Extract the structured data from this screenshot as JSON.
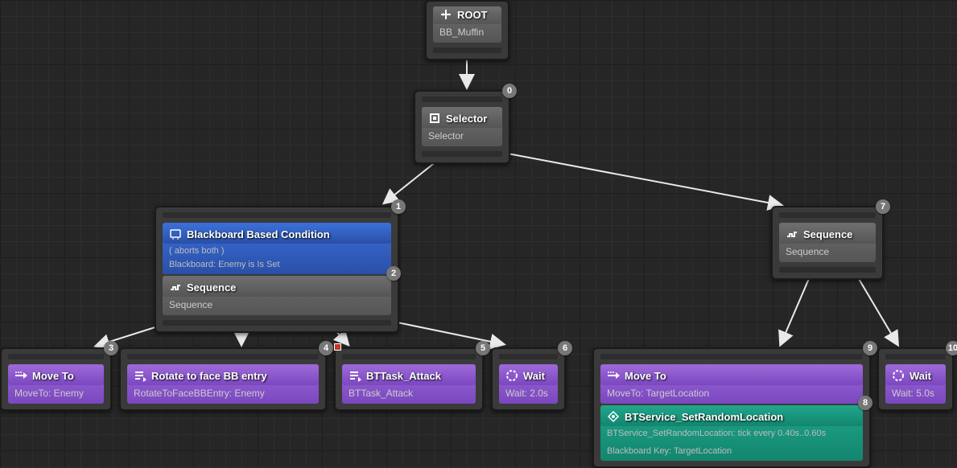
{
  "nodes": {
    "root": {
      "title": "ROOT",
      "subtitle": "BB_Muffin"
    },
    "selector": {
      "index": "0",
      "title": "Selector",
      "subtitle": "Selector"
    },
    "seq1": {
      "index_outer": "1",
      "index_inner": "2",
      "decorator_title": "Blackboard Based Condition",
      "decorator_line1": "( aborts both )",
      "decorator_line2": "Blackboard: Enemy is Is Set",
      "title": "Sequence",
      "subtitle": "Sequence"
    },
    "seq2": {
      "index": "7",
      "title": "Sequence",
      "subtitle": "Sequence"
    },
    "moveto1": {
      "index": "3",
      "title": "Move To",
      "subtitle": "MoveTo: Enemy"
    },
    "rotate": {
      "index": "4",
      "title": "Rotate to face BB entry",
      "subtitle": "RotateToFaceBBEntry: Enemy"
    },
    "attack": {
      "index": "5",
      "title": "BTTask_Attack",
      "subtitle": "BTTask_Attack"
    },
    "wait1": {
      "index": "6",
      "title": "Wait",
      "subtitle": "Wait: 2.0s"
    },
    "moveto2": {
      "index_outer": "9",
      "index_inner": "8",
      "title": "Move To",
      "subtitle": "MoveTo: TargetLocation",
      "service_title": "BTService_SetRandomLocation",
      "service_line1": "BTService_SetRandomLocation: tick every 0.40s..0.60s",
      "service_line2": "Blackboard Key: TargetLocation"
    },
    "wait2": {
      "index": "10",
      "title": "Wait",
      "subtitle": "Wait: 5.0s"
    }
  },
  "chart_data": {
    "type": "tree",
    "tool": "Unreal Engine Behavior Tree",
    "root": "ROOT",
    "blackboard": "BB_Muffin",
    "edges": [
      [
        "ROOT",
        "Selector"
      ],
      [
        "Selector",
        "Sequence(1)"
      ],
      [
        "Selector",
        "Sequence(7)"
      ],
      [
        "Sequence(1)",
        "MoveTo:Enemy(3)"
      ],
      [
        "Sequence(1)",
        "RotateToFaceBBEntry:Enemy(4)"
      ],
      [
        "Sequence(1)",
        "BTTask_Attack(5)"
      ],
      [
        "Sequence(1)",
        "Wait2.0s(6)"
      ],
      [
        "Sequence(7)",
        "MoveTo:TargetLocation(9)"
      ],
      [
        "Sequence(7)",
        "Wait5.0s(10)"
      ]
    ],
    "nodes": [
      {
        "id": "ROOT",
        "type": "root",
        "blackboard": "BB_Muffin"
      },
      {
        "id": "Selector",
        "type": "composite",
        "index": 0
      },
      {
        "id": "Sequence(1)",
        "type": "composite",
        "index": 1,
        "decorators": [
          {
            "type": "Blackboard",
            "abort": "both",
            "condition": "Enemy is Is Set",
            "index": 2
          }
        ]
      },
      {
        "id": "MoveTo:Enemy(3)",
        "type": "task",
        "task": "Move To",
        "key": "Enemy",
        "index": 3
      },
      {
        "id": "RotateToFaceBBEntry:Enemy(4)",
        "type": "task",
        "task": "Rotate to face BB entry",
        "key": "Enemy",
        "index": 4
      },
      {
        "id": "BTTask_Attack(5)",
        "type": "task",
        "task": "BTTask_Attack",
        "index": 5
      },
      {
        "id": "Wait2.0s(6)",
        "type": "task",
        "task": "Wait",
        "seconds": 2.0,
        "index": 6
      },
      {
        "id": "Sequence(7)",
        "type": "composite",
        "index": 7
      },
      {
        "id": "MoveTo:TargetLocation(9)",
        "type": "task",
        "task": "Move To",
        "key": "TargetLocation",
        "index": 9,
        "services": [
          {
            "type": "BTService_SetRandomLocation",
            "interval": [
              0.4,
              0.6
            ],
            "key": "TargetLocation",
            "index": 8
          }
        ]
      },
      {
        "id": "Wait5.0s(10)",
        "type": "task",
        "task": "Wait",
        "seconds": 5.0,
        "index": 10
      }
    ]
  }
}
